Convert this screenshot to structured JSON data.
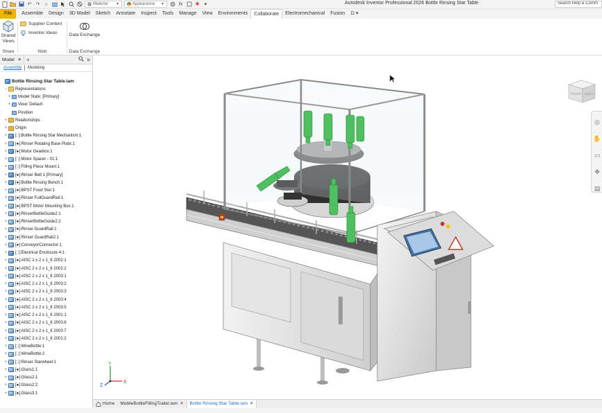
{
  "app": {
    "window_title": "Autodesk Inventor Professional 2026   Bottle Rinsing Star Table",
    "help_search": "Search Help & Comm"
  },
  "quick_access": {
    "material_combo": "Material",
    "appearance_combo": "Appearance",
    "fx_label": "fx"
  },
  "ribbon_tabs": [
    "File",
    "Assemble",
    "Design",
    "3D Model",
    "Sketch",
    "Annotate",
    "Inspect",
    "Tools",
    "Manage",
    "View",
    "Environments",
    "Collaborate",
    "Electromechanical",
    "Fusion"
  ],
  "ribbon_active_tab": "Collaborate",
  "ribbon": {
    "share_btn_line1": "Shared",
    "share_btn_line2": "Views",
    "share_group": "Share",
    "supplier_content": "Supplier Content",
    "inventor_ideas": "Inventor Ideas",
    "web_group": "Web",
    "data_exchange_btn": "Data Exchange",
    "data_exchange_group": "Data Exchange"
  },
  "browser": {
    "tab_model": "Model",
    "tab_close": "✕",
    "tab_add": "+",
    "subtab_assembly": "Assembly",
    "subtab_modeling": "Modeling",
    "tree": [
      {
        "label": "Bottle Rinsing Star Table.iam",
        "type": "root",
        "indent": 0,
        "exp": ""
      },
      {
        "label": "Representations",
        "type": "rep",
        "indent": 1,
        "exp": "−"
      },
      {
        "label": "Model State: [Primary]",
        "type": "small",
        "indent": 2,
        "exp": "+"
      },
      {
        "label": "View: Default",
        "type": "small",
        "indent": 2,
        "exp": "+"
      },
      {
        "label": "Position",
        "type": "small",
        "indent": 2,
        "exp": ""
      },
      {
        "label": "Relationships",
        "type": "folder",
        "indent": 1,
        "exp": "+"
      },
      {
        "label": "Origin",
        "type": "folder",
        "indent": 1,
        "exp": "+"
      },
      {
        "label": "[::]:Bottle Rinsing Star Mechanism:1",
        "type": "asm",
        "indent": 1,
        "exp": "+"
      },
      {
        "label": "[●]:Rinser Rotating Base Plate:1",
        "type": "part",
        "indent": 1,
        "exp": "+"
      },
      {
        "label": "[●]:Motor Gearbox:1",
        "type": "asm",
        "indent": 1,
        "exp": "+"
      },
      {
        "label": "[::]:Motor Spacer - 01:1",
        "type": "part",
        "indent": 1,
        "exp": "+"
      },
      {
        "label": "[::]:Filling Piece Mount:1",
        "type": "part",
        "indent": 1,
        "exp": "+"
      },
      {
        "label": "[●]:Rinser Belt:1 [Primary]",
        "type": "asm",
        "indent": 1,
        "exp": "+"
      },
      {
        "label": "[●]:Bottle Rinsing Bench:1",
        "type": "asm",
        "indent": 1,
        "exp": "+"
      },
      {
        "label": "[●]:BPST Food Stor:1",
        "type": "part",
        "indent": 1,
        "exp": "+"
      },
      {
        "label": "[●]:Rinser FullGuardRail:1",
        "type": "part",
        "indent": 1,
        "exp": "+"
      },
      {
        "label": "[●]:BPST Motor Mounting Box:1",
        "type": "part",
        "indent": 1,
        "exp": "+"
      },
      {
        "label": "[●]:RinserBottleGuide2:1",
        "type": "part",
        "indent": 1,
        "exp": "+"
      },
      {
        "label": "[●]:RinserBottleGuide2:2",
        "type": "part",
        "indent": 1,
        "exp": "+"
      },
      {
        "label": "[●]:Rinser GuardRail:1",
        "type": "part",
        "indent": 1,
        "exp": "+"
      },
      {
        "label": "[●]:Rinser GuardRail2:1",
        "type": "part",
        "indent": 1,
        "exp": "+"
      },
      {
        "label": "[●]:ConveyorConnector:1",
        "type": "part",
        "indent": 1,
        "exp": "+"
      },
      {
        "label": "[::]:Electrical Enclosure 4:1",
        "type": "asm",
        "indent": 1,
        "exp": "+"
      },
      {
        "label": "[●]:AISC 2 x 2 x 1_8 2002:1",
        "type": "part",
        "indent": 1,
        "exp": "+"
      },
      {
        "label": "[●]:AISC 2 x 2 x 1_8 2002:2",
        "type": "part",
        "indent": 1,
        "exp": "+"
      },
      {
        "label": "[●]:AISC 2 x 2 x 1_8 2003:1",
        "type": "part",
        "indent": 1,
        "exp": "+"
      },
      {
        "label": "[●]:AISC 2 x 2 x 1_8 2003:2",
        "type": "part",
        "indent": 1,
        "exp": "+"
      },
      {
        "label": "[●]:AISC 2 x 2 x 1_8 2003:3",
        "type": "part",
        "indent": 1,
        "exp": "+"
      },
      {
        "label": "[●]:AISC 2 x 2 x 1_8 2003:4",
        "type": "part",
        "indent": 1,
        "exp": "+"
      },
      {
        "label": "[●]:AISC 2 x 2 x 1_8 2003:5",
        "type": "part",
        "indent": 1,
        "exp": "+"
      },
      {
        "label": "[●]:AISC 2 x 2 x 1_8 2001:1",
        "type": "part",
        "indent": 1,
        "exp": "+"
      },
      {
        "label": "[●]:AISC 2 x 2 x 1_8 2003:6",
        "type": "part",
        "indent": 1,
        "exp": "+"
      },
      {
        "label": "[●]:AISC 2 x 2 x 1_8 2003:7",
        "type": "part",
        "indent": 1,
        "exp": "+"
      },
      {
        "label": "[●]:AISC 2 x 2 x 1_8 2001:2",
        "type": "part",
        "indent": 1,
        "exp": "+"
      },
      {
        "label": "[::]:WineBottle:1",
        "type": "part",
        "indent": 1,
        "exp": "+"
      },
      {
        "label": "[::]:WineBottle:2",
        "type": "part",
        "indent": 1,
        "exp": "+"
      },
      {
        "label": "[::]:Rinser Starwheel:1",
        "type": "part",
        "indent": 1,
        "exp": "+"
      },
      {
        "label": "[●]:Glass1:1",
        "type": "part",
        "indent": 1,
        "exp": "+"
      },
      {
        "label": "[●]:Glass2:1",
        "type": "part",
        "indent": 1,
        "exp": "+"
      },
      {
        "label": "[●]:Glass2:2",
        "type": "part",
        "indent": 1,
        "exp": "+"
      },
      {
        "label": "[●]:Glass3:1",
        "type": "part",
        "indent": 1,
        "exp": "+"
      }
    ]
  },
  "viewcube": {
    "front": "FRONT",
    "right": "RIGHT"
  },
  "triad": {
    "x": "X",
    "y": "Y",
    "z": "Z"
  },
  "doc_tabs": [
    {
      "label": "Home",
      "active": false
    },
    {
      "label": "MobileBottleFillingTrailer.iam",
      "active": false
    },
    {
      "label": "Bottle Rinsing Star Table.iam",
      "active": true
    }
  ],
  "colors": {
    "file_tab": "#f0b400",
    "accent": "#1b6ec2",
    "bottle_green": "#4fbf5f"
  }
}
